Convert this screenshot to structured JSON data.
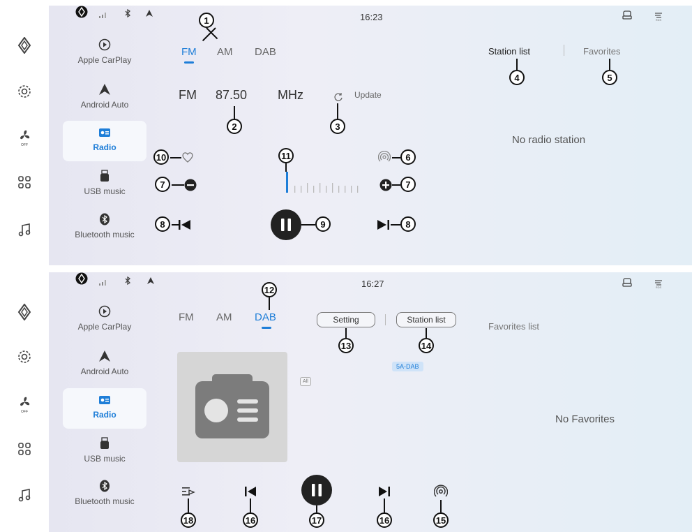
{
  "top": {
    "clock": "16:23",
    "sources": [
      {
        "label": "Apple CarPlay",
        "icon": "carplay-icon"
      },
      {
        "label": "Android Auto",
        "icon": "android-auto-icon"
      },
      {
        "label": "Radio",
        "icon": "radio-icon",
        "active": true
      },
      {
        "label": "USB music",
        "icon": "usb-icon"
      },
      {
        "label": "Bluetooth music",
        "icon": "bluetooth-icon"
      }
    ],
    "bands": [
      "FM",
      "AM",
      "DAB"
    ],
    "active_band": "FM",
    "freq_band": "FM",
    "frequency": "87.50",
    "unit": "MHz",
    "update_label": "Update",
    "tabs": {
      "station_list": "Station list",
      "favorites": "Favorites"
    },
    "empty_message": "No radio station",
    "callouts": [
      "1",
      "2",
      "3",
      "4",
      "5",
      "6",
      "7",
      "7",
      "8",
      "8",
      "9",
      "10",
      "11"
    ]
  },
  "bottom": {
    "clock": "16:27",
    "sources": [
      {
        "label": "Apple CarPlay",
        "icon": "carplay-icon"
      },
      {
        "label": "Android Auto",
        "icon": "android-auto-icon"
      },
      {
        "label": "Radio",
        "icon": "radio-icon",
        "active": true
      },
      {
        "label": "USB music",
        "icon": "usb-icon"
      },
      {
        "label": "Bluetooth music",
        "icon": "bluetooth-icon"
      }
    ],
    "bands": [
      "FM",
      "AM",
      "DAB"
    ],
    "active_band": "DAB",
    "setting_label": "Setting",
    "station_list_label": "Station list",
    "dab_tag": "5A-DAB",
    "all_label": "All",
    "favorites_title": "Favorites list",
    "empty_message": "No Favorites",
    "callouts": [
      "12",
      "13",
      "14",
      "15",
      "16",
      "16",
      "17",
      "18"
    ]
  },
  "colors": {
    "accent": "#1e7ed8",
    "dark": "#222222",
    "art_bg": "#d6d6d6",
    "art_icon": "#7c7c7c"
  }
}
